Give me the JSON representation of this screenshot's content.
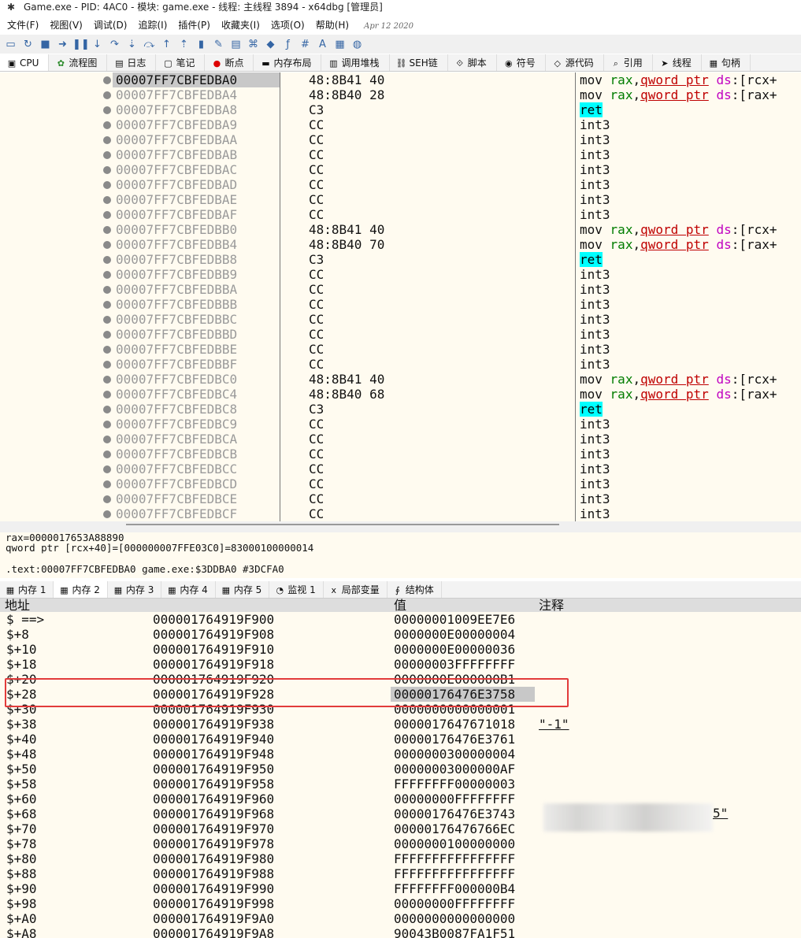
{
  "window": {
    "title": "Game.exe - PID: 4AC0 - 模块: game.exe - 线程: 主线程 3894 - x64dbg [管理员]"
  },
  "menu": [
    "文件(F)",
    "视图(V)",
    "调试(D)",
    "追踪(I)",
    "插件(P)",
    "收藏夹(I)",
    "选项(O)",
    "帮助(H)"
  ],
  "menu_date": "Apr 12 2020",
  "toolbar": [
    "open-icon",
    "restart-icon",
    "stop-icon",
    "run-icon",
    "pause-icon",
    "step-into-icon",
    "step-over-icon",
    "trace-into-icon",
    "trace-over-icon",
    "execute-till-return-icon",
    "run-to-user-code-icon",
    "scylla-icon",
    "patch-icon",
    "comment-icon",
    "label-icon",
    "bookmark-icon",
    "function-icon",
    "hash-icon",
    "font-icon",
    "calculator-icon",
    "globe-icon"
  ],
  "tabs_top": [
    {
      "label": "CPU",
      "icon": "cpu-icon",
      "active": true
    },
    {
      "label": "流程图",
      "icon": "graph-icon"
    },
    {
      "label": "日志",
      "icon": "log-icon"
    },
    {
      "label": "笔记",
      "icon": "notes-icon"
    },
    {
      "label": "断点",
      "icon": "breakpoint-icon"
    },
    {
      "label": "内存布局",
      "icon": "memory-map-icon"
    },
    {
      "label": "调用堆栈",
      "icon": "callstack-icon"
    },
    {
      "label": "SEH链",
      "icon": "seh-icon"
    },
    {
      "label": "脚本",
      "icon": "script-icon"
    },
    {
      "label": "符号",
      "icon": "symbol-icon"
    },
    {
      "label": "源代码",
      "icon": "source-icon"
    },
    {
      "label": "引用",
      "icon": "references-icon"
    },
    {
      "label": "线程",
      "icon": "threads-icon"
    },
    {
      "label": "句柄",
      "icon": "handles-icon"
    }
  ],
  "disasm": [
    {
      "addr": "00007FF7CBFEDBA0",
      "bytes": "48:8B41 40",
      "kind": "movrcx",
      "disp": "rcx+",
      "sel": true
    },
    {
      "addr": "00007FF7CBFEDBA4",
      "bytes": "48:8B40 28",
      "kind": "movrax",
      "disp": "rax+"
    },
    {
      "addr": "00007FF7CBFEDBA8",
      "bytes": "C3",
      "kind": "ret"
    },
    {
      "addr": "00007FF7CBFEDBA9",
      "bytes": "CC",
      "kind": "int3"
    },
    {
      "addr": "00007FF7CBFEDBAA",
      "bytes": "CC",
      "kind": "int3"
    },
    {
      "addr": "00007FF7CBFEDBAB",
      "bytes": "CC",
      "kind": "int3"
    },
    {
      "addr": "00007FF7CBFEDBAC",
      "bytes": "CC",
      "kind": "int3"
    },
    {
      "addr": "00007FF7CBFEDBAD",
      "bytes": "CC",
      "kind": "int3"
    },
    {
      "addr": "00007FF7CBFEDBAE",
      "bytes": "CC",
      "kind": "int3"
    },
    {
      "addr": "00007FF7CBFEDBAF",
      "bytes": "CC",
      "kind": "int3"
    },
    {
      "addr": "00007FF7CBFEDBB0",
      "bytes": "48:8B41 40",
      "kind": "movrcx",
      "disp": "rcx+"
    },
    {
      "addr": "00007FF7CBFEDBB4",
      "bytes": "48:8B40 70",
      "kind": "movrax",
      "disp": "rax+"
    },
    {
      "addr": "00007FF7CBFEDBB8",
      "bytes": "C3",
      "kind": "ret"
    },
    {
      "addr": "00007FF7CBFEDBB9",
      "bytes": "CC",
      "kind": "int3"
    },
    {
      "addr": "00007FF7CBFEDBBA",
      "bytes": "CC",
      "kind": "int3"
    },
    {
      "addr": "00007FF7CBFEDBBB",
      "bytes": "CC",
      "kind": "int3"
    },
    {
      "addr": "00007FF7CBFEDBBC",
      "bytes": "CC",
      "kind": "int3"
    },
    {
      "addr": "00007FF7CBFEDBBD",
      "bytes": "CC",
      "kind": "int3"
    },
    {
      "addr": "00007FF7CBFEDBBE",
      "bytes": "CC",
      "kind": "int3"
    },
    {
      "addr": "00007FF7CBFEDBBF",
      "bytes": "CC",
      "kind": "int3"
    },
    {
      "addr": "00007FF7CBFEDBC0",
      "bytes": "48:8B41 40",
      "kind": "movrcx",
      "disp": "rcx+"
    },
    {
      "addr": "00007FF7CBFEDBC4",
      "bytes": "48:8B40 68",
      "kind": "movrax",
      "disp": "rax+"
    },
    {
      "addr": "00007FF7CBFEDBC8",
      "bytes": "C3",
      "kind": "ret"
    },
    {
      "addr": "00007FF7CBFEDBC9",
      "bytes": "CC",
      "kind": "int3"
    },
    {
      "addr": "00007FF7CBFEDBCA",
      "bytes": "CC",
      "kind": "int3"
    },
    {
      "addr": "00007FF7CBFEDBCB",
      "bytes": "CC",
      "kind": "int3"
    },
    {
      "addr": "00007FF7CBFEDBCC",
      "bytes": "CC",
      "kind": "int3"
    },
    {
      "addr": "00007FF7CBFEDBCD",
      "bytes": "CC",
      "kind": "int3"
    },
    {
      "addr": "00007FF7CBFEDBCE",
      "bytes": "CC",
      "kind": "int3"
    },
    {
      "addr": "00007FF7CBFEDBCF",
      "bytes": "CC",
      "kind": "int3"
    }
  ],
  "asm_tokens": {
    "mov": "mov",
    "rax": "rax",
    "ptr": "qword ptr",
    "seg": "ds",
    "ret": "ret",
    "int3": "int3"
  },
  "info": {
    "line1": "rax=0000017653A88890",
    "line2": "qword ptr [rcx+40]=[000000007FFE03C0]=83000100000014",
    "line3": ".text:00007FF7CBFEDBA0 game.exe:$3DDBA0 #3DCFA0"
  },
  "tabs_bottom": [
    {
      "label": "内存 1",
      "icon": "dump-icon"
    },
    {
      "label": "内存 2",
      "icon": "dump-icon",
      "active": true
    },
    {
      "label": "内存 3",
      "icon": "dump-icon"
    },
    {
      "label": "内存 4",
      "icon": "dump-icon"
    },
    {
      "label": "内存 5",
      "icon": "dump-icon"
    },
    {
      "label": "监视 1",
      "icon": "watch-icon"
    },
    {
      "label": "局部变量",
      "icon": "locals-icon"
    },
    {
      "label": "结构体",
      "icon": "struct-icon"
    }
  ],
  "dump_headers": {
    "addr": "地址",
    "value": "值",
    "comment": "注释"
  },
  "dump_rows": [
    {
      "off": "$ ==>",
      "addr": "000001764919F900",
      "val": "00000001009EE7E6",
      "cm": ""
    },
    {
      "off": "$+8",
      "addr": "000001764919F908",
      "val": "0000000E00000004",
      "cm": ""
    },
    {
      "off": "$+10",
      "addr": "000001764919F910",
      "val": "0000000E00000036",
      "cm": ""
    },
    {
      "off": "$+18",
      "addr": "000001764919F918",
      "val": "00000003FFFFFFFF",
      "cm": ""
    },
    {
      "off": "$+20",
      "addr": "000001764919F920",
      "val": "0000000E000000B1",
      "cm": ""
    },
    {
      "off": "$+28",
      "addr": "000001764919F928",
      "val": "00000176476E3758",
      "cm": "",
      "sel": true
    },
    {
      "off": "$+30",
      "addr": "000001764919F930",
      "val": "0000000000000001",
      "cm": ""
    },
    {
      "off": "$+38",
      "addr": "000001764919F938",
      "val": "0000017647671018",
      "cm": "\"-1\""
    },
    {
      "off": "$+40",
      "addr": "000001764919F940",
      "val": "00000176476E3761",
      "cm": ""
    },
    {
      "off": "$+48",
      "addr": "000001764919F948",
      "val": "0000000300000004",
      "cm": ""
    },
    {
      "off": "$+50",
      "addr": "000001764919F950",
      "val": "00000003000000AF",
      "cm": ""
    },
    {
      "off": "$+58",
      "addr": "000001764919F958",
      "val": "FFFFFFFF00000003",
      "cm": ""
    },
    {
      "off": "$+60",
      "addr": "000001764919F960",
      "val": "00000000FFFFFFFF",
      "cm": ""
    },
    {
      "off": "$+68",
      "addr": "000001764919F968",
      "val": "00000176476E3743",
      "cm": ""
    },
    {
      "off": "$+70",
      "addr": "000001764919F970",
      "val": "00000176476766EC",
      "cm": ""
    },
    {
      "off": "$+78",
      "addr": "000001764919F978",
      "val": "0000000100000000",
      "cm": ""
    },
    {
      "off": "$+80",
      "addr": "000001764919F980",
      "val": "FFFFFFFFFFFFFFFF",
      "cm": ""
    },
    {
      "off": "$+88",
      "addr": "000001764919F988",
      "val": "FFFFFFFFFFFFFFFF",
      "cm": ""
    },
    {
      "off": "$+90",
      "addr": "000001764919F990",
      "val": "FFFFFFFF000000B4",
      "cm": ""
    },
    {
      "off": "$+98",
      "addr": "000001764919F998",
      "val": "00000000FFFFFFFF",
      "cm": ""
    },
    {
      "off": "$+A0",
      "addr": "000001764919F9A0",
      "val": "0000000000000000",
      "cm": ""
    },
    {
      "off": "$+A8",
      "addr": "000001764919F9A8",
      "val": "90043B0087FA1F51",
      "cm": ""
    }
  ],
  "redacted_tail": "5\"",
  "colors": {
    "bg": "#fffbf0",
    "selection": "#c8c8c8",
    "register": "#007d00",
    "pointer": "#bf0000",
    "segment": "#c000c0",
    "ret_bg": "#00ffff",
    "highlight_box": "#e23b3b"
  }
}
